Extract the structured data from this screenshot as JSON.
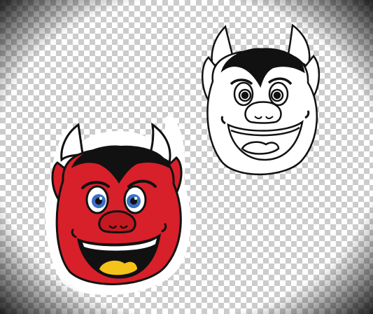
{
  "colors": {
    "skin": "#d8202a",
    "skin_dark": "#a3121b",
    "hair": "#111111",
    "horn": "#ffffff",
    "outline": "#111111",
    "eye_iris": "#3b6fc4",
    "mouth": "#111111",
    "tongue": "#f5c21a",
    "background_light": "#ffffff",
    "background_dark": "#cccccc"
  },
  "icons": {
    "colored": "devil-mascot-color-icon",
    "outline": "devil-mascot-outline-icon"
  }
}
